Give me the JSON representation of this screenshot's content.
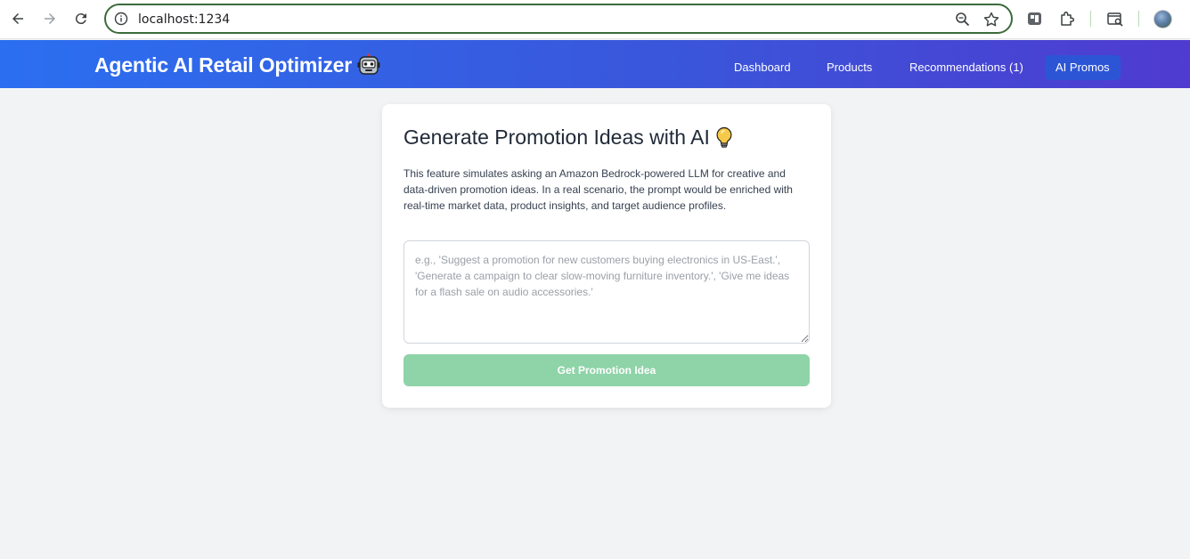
{
  "browser": {
    "url": "localhost:1234"
  },
  "header": {
    "brand": "Agentic AI Retail Optimizer",
    "nav": [
      {
        "label": "Dashboard",
        "active": false
      },
      {
        "label": "Products",
        "active": false
      },
      {
        "label": "Recommendations (1)",
        "active": false
      },
      {
        "label": "AI Promos",
        "active": true
      }
    ]
  },
  "promo_card": {
    "title": "Generate Promotion Ideas with AI",
    "description": "This feature simulates asking an Amazon Bedrock-powered LLM for creative and data-driven promotion ideas. In a real scenario, the prompt would be enriched with real-time market data, product insights, and target audience profiles.",
    "prompt_value": "",
    "prompt_placeholder": "e.g., 'Suggest a promotion for new customers buying electronics in US-East.', 'Generate a campaign to clear slow-moving furniture inventory.', 'Give me ideas for a flash sale on audio accessories.'",
    "submit_label": "Get Promotion Idea"
  },
  "colors": {
    "header_gradient_start": "#2b6ff0",
    "header_gradient_end": "#4f3bd0",
    "active_nav": "#2c55d6",
    "submit_disabled": "#8fd3a8",
    "page_bg": "#f2f3f5"
  }
}
